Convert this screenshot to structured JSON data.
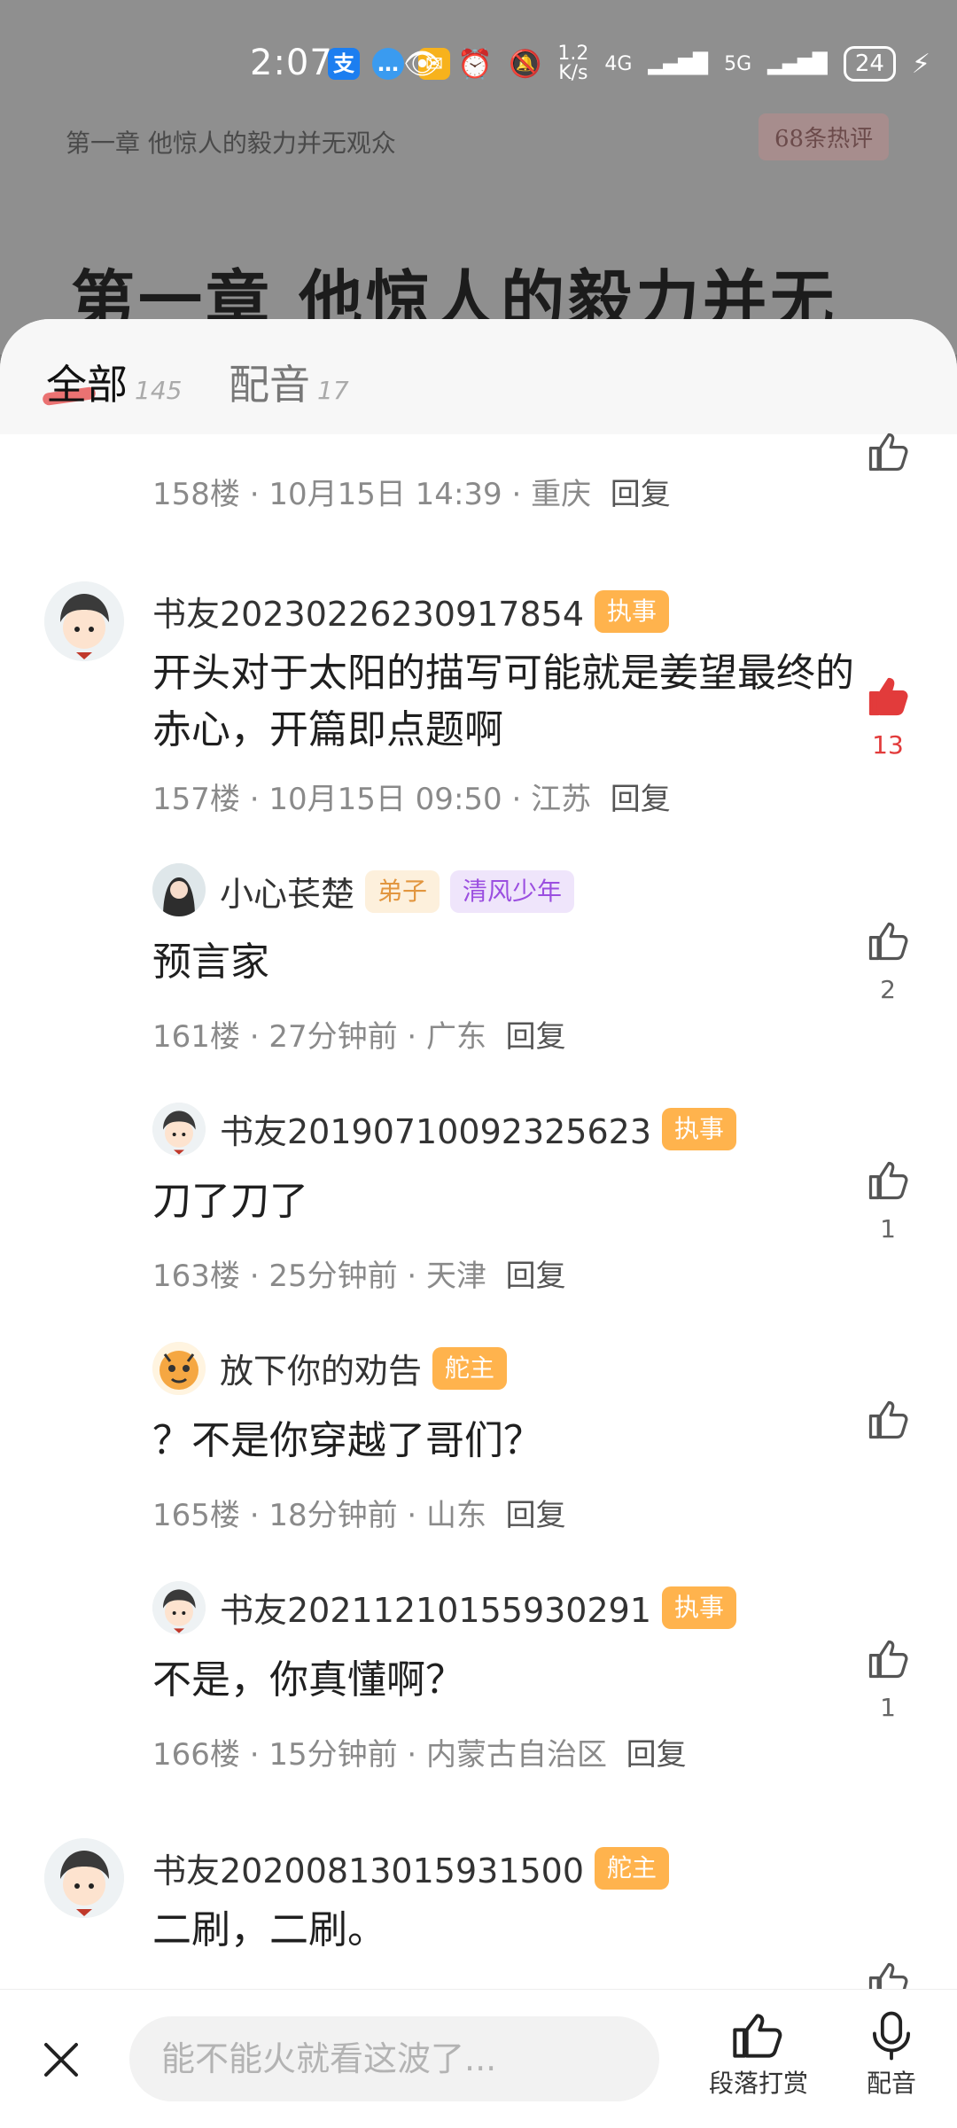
{
  "status_bar": {
    "time": "2:07",
    "network_speed_value": "1.2",
    "network_speed_unit": "K/s",
    "signal_1": "4G",
    "signal_2": "5G",
    "battery": "24"
  },
  "reader": {
    "chapter_title_small": "第一章 他惊人的毅力并无观众",
    "hot_comments": "68条热评",
    "chapter_title_big": "第一章 他惊人的毅力并无"
  },
  "tabs": [
    {
      "label": "全部",
      "count": "145"
    },
    {
      "label": "配音",
      "count": "17"
    }
  ],
  "comments": [
    {
      "floor": "158楼",
      "time": "10月15日 14:39",
      "location": "重庆",
      "reply": "回复",
      "likes": ""
    },
    {
      "author": "书友20230226230917854",
      "badges": [
        "执事"
      ],
      "text": "开头对于太阳的描写可能就是姜望最终的赤心，开篇即点题啊",
      "floor": "157楼",
      "time": "10月15日 09:50",
      "location": "江苏",
      "reply": "回复",
      "likes": "13"
    },
    {
      "author": "小心苌楚",
      "badges": [
        "弟子",
        "清风少年"
      ],
      "text": "预言家",
      "floor": "161楼",
      "time": "27分钟前",
      "location": "广东",
      "reply": "回复",
      "likes": "2"
    },
    {
      "author": "书友20190710092325623",
      "badges": [
        "执事"
      ],
      "text": "刀了刀了",
      "floor": "163楼",
      "time": "25分钟前",
      "location": "天津",
      "reply": "回复",
      "likes": "1"
    },
    {
      "author": "放下你的劝告",
      "badges": [
        "舵主"
      ],
      "text": "？不是你穿越了哥们？",
      "floor": "165楼",
      "time": "18分钟前",
      "location": "山东",
      "reply": "回复",
      "likes": ""
    },
    {
      "author": "书友20211210155930291",
      "badges": [
        "执事"
      ],
      "text": "不是，你真懂啊？",
      "floor": "166楼",
      "time": "15分钟前",
      "location": "内蒙古自治区",
      "reply": "回复",
      "likes": "1"
    },
    {
      "author": "书友20200813015931500",
      "badges": [
        "舵主"
      ],
      "text": "二刷，二刷。",
      "likes": ""
    }
  ],
  "bottom_bar": {
    "input_placeholder": "能不能火就看这波了...",
    "reward_label": "段落打赏",
    "voice_label": "配音"
  },
  "colors": {
    "accent_red": "#e23b3b",
    "badge_orange": "#ffb34d"
  }
}
